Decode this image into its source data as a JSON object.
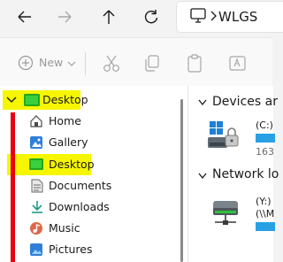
{
  "address": {
    "text": "WLGS"
  },
  "toolbar": {
    "new_label": "New"
  },
  "nav": {
    "items": [
      {
        "label": "Desktop"
      },
      {
        "label": "Home"
      },
      {
        "label": "Gallery"
      },
      {
        "label": "Desktop"
      },
      {
        "label": "Documents"
      },
      {
        "label": "Downloads"
      },
      {
        "label": "Music"
      },
      {
        "label": "Pictures"
      }
    ]
  },
  "content": {
    "devices_heading": "Devices ar",
    "drive_c_label": "(C:)",
    "drive_c_free": "163",
    "network_heading": "Network lo",
    "drive_y_label": "(Y:)",
    "drive_y_path": "(\\\\M"
  },
  "colors": {
    "highlight": "#f6f600",
    "annotation_red": "#e8000d",
    "usage_bar": "#28a0e4",
    "folder_green": "#1fa81f"
  }
}
